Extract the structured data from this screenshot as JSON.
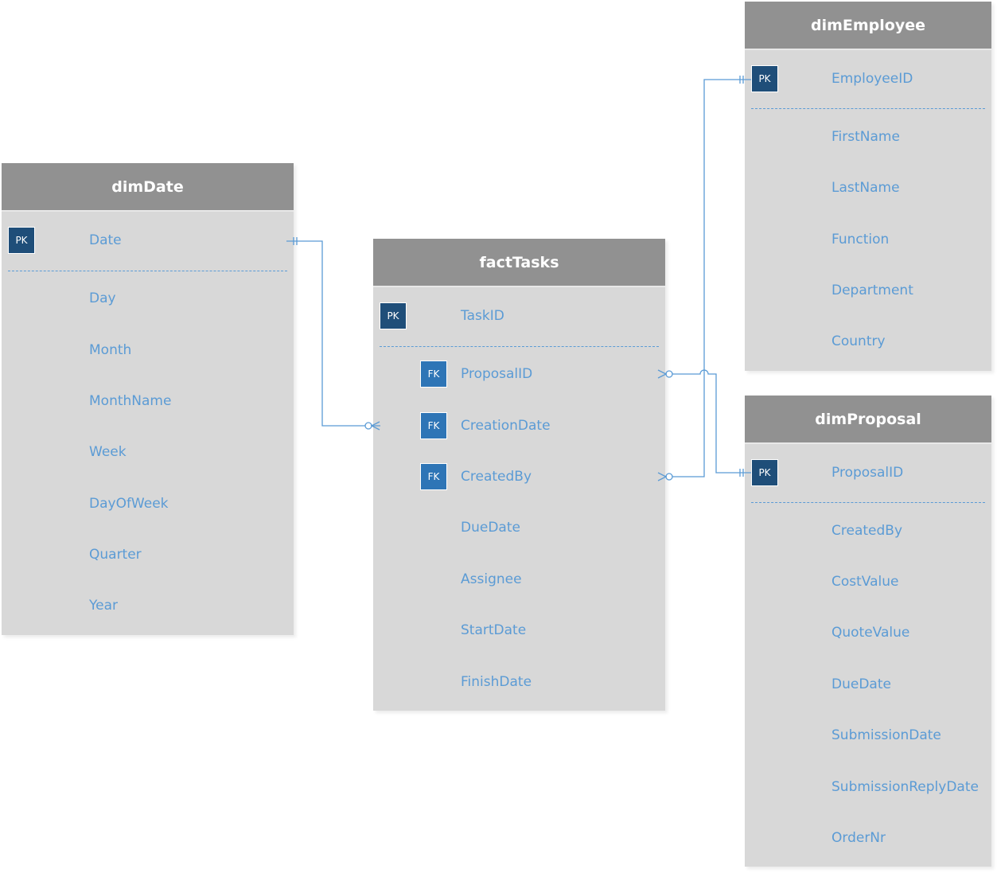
{
  "colors": {
    "header": "#919191",
    "body": "#d8d8d8",
    "pk": "#1f4e79",
    "fk": "#2e75b6",
    "field_text": "#5b9bd5",
    "connector": "#5b9bd5"
  },
  "tables": [
    {
      "id": "dimDate",
      "title": "dimDate",
      "pk": {
        "badge": "PK",
        "field": "Date"
      },
      "fields": [
        {
          "name": "Day"
        },
        {
          "name": "Month"
        },
        {
          "name": "MonthName"
        },
        {
          "name": "Week"
        },
        {
          "name": "DayOfWeek"
        },
        {
          "name": "Quarter"
        },
        {
          "name": "Year"
        }
      ]
    },
    {
      "id": "factTasks",
      "title": "factTasks",
      "pk": {
        "badge": "PK",
        "field": "TaskID"
      },
      "fields": [
        {
          "name": "ProposalID",
          "badge": "FK"
        },
        {
          "name": "CreationDate",
          "badge": "FK"
        },
        {
          "name": "CreatedBy",
          "badge": "FK"
        },
        {
          "name": "DueDate"
        },
        {
          "name": "Assignee"
        },
        {
          "name": "StartDate"
        },
        {
          "name": "FinishDate"
        }
      ]
    },
    {
      "id": "dimEmployee",
      "title": "dimEmployee",
      "pk": {
        "badge": "PK",
        "field": "EmployeeID"
      },
      "fields": [
        {
          "name": "FirstName"
        },
        {
          "name": "LastName"
        },
        {
          "name": "Function"
        },
        {
          "name": "Department"
        },
        {
          "name": "Country"
        }
      ]
    },
    {
      "id": "dimProposal",
      "title": "dimProposal",
      "pk": {
        "badge": "PK",
        "field": "ProposalID"
      },
      "fields": [
        {
          "name": "CreatedBy"
        },
        {
          "name": "CostValue"
        },
        {
          "name": "QuoteValue"
        },
        {
          "name": "DueDate"
        },
        {
          "name": "SubmissionDate"
        },
        {
          "name": "SubmissionReplyDate"
        },
        {
          "name": "OrderNr"
        }
      ]
    }
  ],
  "relationships": [
    {
      "from": "dimDate.Date",
      "to": "factTasks.CreationDate",
      "from_end": "one-and-only-one",
      "to_end": "zero-or-many"
    },
    {
      "from": "dimProposal.ProposalID",
      "to": "factTasks.ProposalID",
      "from_end": "one-and-only-one",
      "to_end": "zero-or-many"
    },
    {
      "from": "dimEmployee.EmployeeID",
      "to": "factTasks.CreatedBy",
      "from_end": "one-and-only-one",
      "to_end": "zero-or-many"
    }
  ]
}
